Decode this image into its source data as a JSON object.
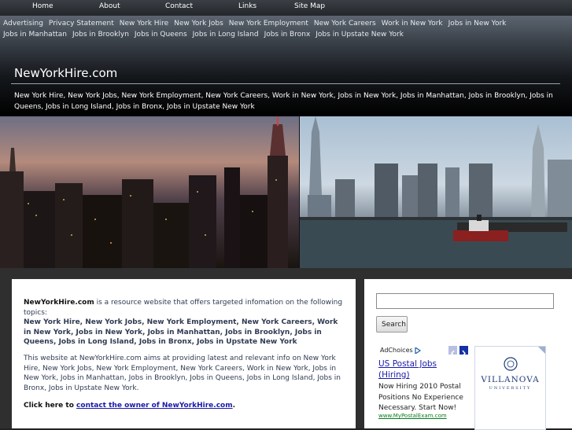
{
  "top_nav": [
    "Home",
    "About",
    "Contact",
    "Links",
    "Site Map"
  ],
  "header_links": [
    "Advertising",
    "Privacy Statement",
    "New York Hire",
    "New York Jobs",
    "New York Employment",
    "New York Careers",
    "Work in New York",
    "Jobs in New York",
    "Jobs in Manhattan",
    "Jobs in Brooklyn",
    "Jobs in Queens",
    "Jobs in Long Island",
    "Jobs in Bronx",
    "Jobs in Upstate New York"
  ],
  "site_title": "NewYorkHire.com",
  "tagline": "New York Hire, New York Jobs, New York Employment, New York Careers, Work in New York, Jobs in New York, Jobs in Manhattan, Jobs in Brooklyn, Jobs in Queens, Jobs in Long Island, Jobs in Bronx, Jobs in Upstate New York",
  "content": {
    "intro_bold": "NewYorkHire.com",
    "intro_rest": " is a resource website that offers targeted infomation on the following topics:",
    "topics": "New York Hire, New York Jobs, New York Employment, New York Careers, Work in New York, Jobs in New York, Jobs in Manhattan, Jobs in Brooklyn, Jobs in Queens, Jobs in Long Island, Jobs in Bronx, Jobs in Upstate New York",
    "aim": "This website at NewYorkHire.com aims at providing latest and relevant info on New York Hire, New York Jobs, New York Employment, New York Careers, Work in New York, Jobs in New York, Jobs in Manhattan, Jobs in Brooklyn, Jobs in Queens, Jobs in Long Island, Jobs in Bronx, Jobs in Upstate New York.",
    "click_prefix": "Click here to ",
    "contact_link": "contact the owner of NewYorkHire.com",
    "click_suffix": "."
  },
  "sidebar": {
    "search_value": "",
    "search_button": "Search"
  },
  "ad": {
    "adchoices": "AdChoices",
    "title": "US Postal Jobs (Hiring)",
    "text": "Now Hiring 2010 Postal Positions No Experience Necessary. Start Now!",
    "url": "www.MyPostalExam.com"
  },
  "ad2": {
    "logo": "VILLANOVA",
    "sub": "UNIVERSITY"
  },
  "colors": {
    "link_blue": "#1a1aa8",
    "text_navy": "#2f3b52",
    "ad_url_green": "#0b7a1e"
  }
}
